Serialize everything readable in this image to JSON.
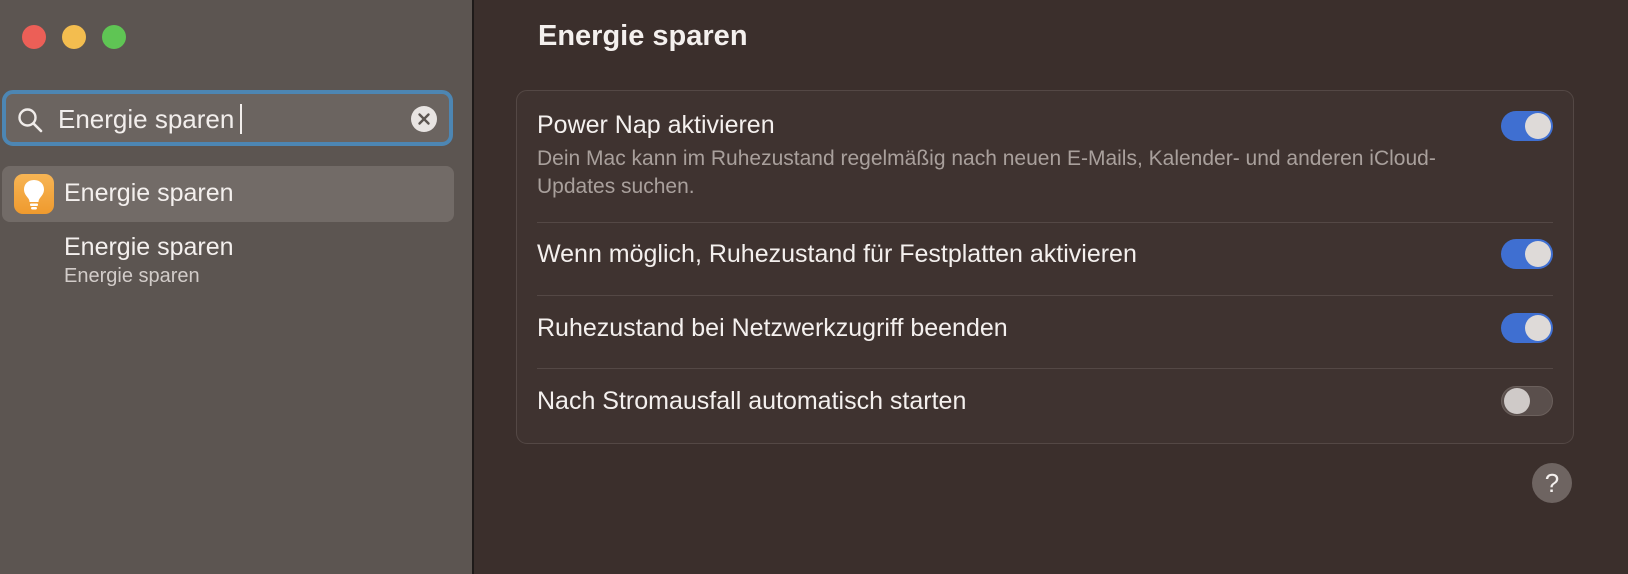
{
  "window": {
    "controls": [
      "close",
      "minimize",
      "maximize"
    ]
  },
  "sidebar": {
    "search": {
      "value": "Energie sparen",
      "icon": "magnifying-glass",
      "clear_icon": "x-circle"
    },
    "results": [
      {
        "label": "Energie sparen",
        "icon": "lightbulb-icon",
        "selected": true
      }
    ],
    "subresults": [
      {
        "title": "Energie sparen",
        "subtitle": "Energie sparen"
      }
    ]
  },
  "main": {
    "title": "Energie sparen",
    "settings": [
      {
        "label": "Power Nap aktivieren",
        "description": "Dein Mac kann im Ruhezustand regelmäßig nach neuen E-Mails, Kalender- und anderen iCloud-Updates suchen.",
        "enabled": true
      },
      {
        "label": "Wenn möglich, Ruhezustand für Festplatten aktivieren",
        "enabled": true
      },
      {
        "label": "Ruhezustand bei Netzwerkzugriff beenden",
        "enabled": true
      },
      {
        "label": "Nach Stromausfall automatisch starten",
        "enabled": false
      }
    ],
    "help_label": "?"
  },
  "colors": {
    "sidebar_bg": "#5c5551",
    "main_bg": "#3b2f2c",
    "toggle_on": "#3f6fd1",
    "search_focus": "#4d86b3",
    "app_icon": "#f2a63e"
  }
}
